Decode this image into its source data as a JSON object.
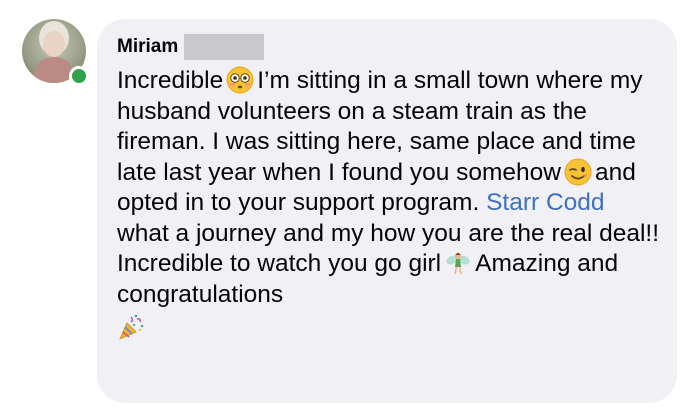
{
  "author": {
    "name": "Miriam"
  },
  "comment": {
    "part1": "Incredible",
    "part2": "I’m sitting in a small town where my husband volunteers on a steam train as the fireman. I was sitting here, same place and time late last year when I found you somehow",
    "part3": "and opted in to your support program.",
    "mention": "Starr Codd",
    "part4": "what a journey and my how you are the real deal!! Incredible to watch you go girl",
    "part5": "Amazing and congratulations"
  },
  "emojis": [
    "flushed-face",
    "winking-face",
    "fairy",
    "party-popper"
  ],
  "colors": {
    "bubble": "#f0f0f5",
    "mention": "#3d71c3",
    "online": "#31a24c"
  }
}
